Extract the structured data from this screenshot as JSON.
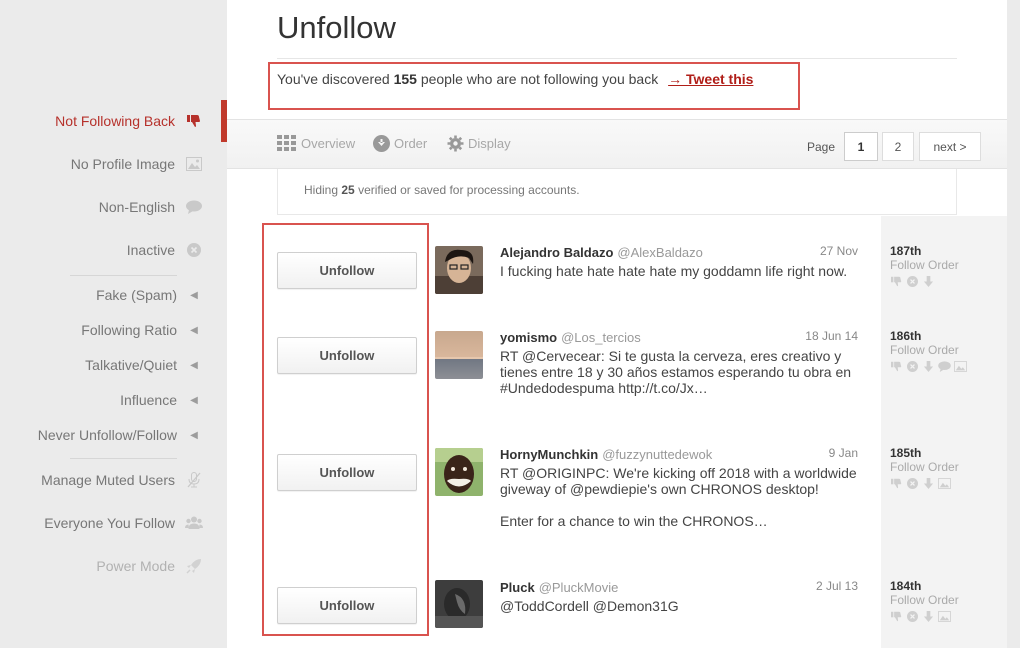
{
  "sidebar": {
    "items": [
      {
        "label": "Not Following Back",
        "icon": "thumbs-down-icon"
      },
      {
        "label": "No Profile Image",
        "icon": "image-icon"
      },
      {
        "label": "Non-English",
        "icon": "speech-bubble-icon"
      },
      {
        "label": "Inactive",
        "icon": "clock-icon"
      },
      {
        "label": "Fake (Spam)",
        "icon": "caret-left-icon"
      },
      {
        "label": "Following Ratio",
        "icon": "caret-left-icon"
      },
      {
        "label": "Talkative/Quiet",
        "icon": "caret-left-icon"
      },
      {
        "label": "Influence",
        "icon": "caret-left-icon"
      },
      {
        "label": "Never Unfollow/Follow",
        "icon": "caret-left-icon"
      },
      {
        "label": "Manage Muted Users",
        "icon": "muted-mic-icon"
      },
      {
        "label": "Everyone You Follow",
        "icon": "group-icon"
      },
      {
        "label": "Power Mode",
        "icon": "rocket-icon"
      }
    ]
  },
  "header": {
    "title": "Unfollow",
    "discover_prefix": "You've discovered",
    "discover_count": "155",
    "discover_suffix": "people who are not following you back",
    "tweet_link": "→ Tweet this"
  },
  "toolbar": {
    "overview": "Overview",
    "order": "Order",
    "display": "Display",
    "page_label": "Page",
    "pages": [
      "1",
      "2"
    ],
    "next": "next >"
  },
  "notice": {
    "prefix": "Hiding",
    "count": "25",
    "suffix": "verified or saved for processing accounts."
  },
  "rows": [
    {
      "button": "Unfollow",
      "name": "Alejandro Baldazo",
      "handle": "@AlexBaldazo",
      "date": "27 Nov",
      "text": "I fucking hate hate hate hate my goddamn life right now.",
      "rank": "187th",
      "rank_label": "Follow Order"
    },
    {
      "button": "Unfollow",
      "name": "yomismo",
      "handle": "@Los_tercios",
      "date": "18 Jun 14",
      "text": "RT @Cervecear: Si te gusta la cerveza, eres creativo y tienes entre 18 y 30 años estamos esperando tu obra en #Undedodespuma http://t.co/Jx…",
      "rank": "186th",
      "rank_label": "Follow Order"
    },
    {
      "button": "Unfollow",
      "name": "HornyMunchkin",
      "handle": "@fuzzynuttedewok",
      "date": "9 Jan",
      "text": "RT @ORIGINPC: We're kicking off 2018 with a worldwide giveway of @pewdiepie's own CHRONOS desktop!\n\nEnter for a chance to win the CHRONOS…",
      "rank": "185th",
      "rank_label": "Follow Order"
    },
    {
      "button": "Unfollow",
      "name": "Pluck",
      "handle": "@PluckMovie",
      "date": "2 Jul 13",
      "text": "@ToddCordell @Demon31G",
      "rank": "184th",
      "rank_label": "Follow Order"
    }
  ],
  "colors": {
    "accent": "#b6312b",
    "highlight_box": "#d9534f"
  }
}
